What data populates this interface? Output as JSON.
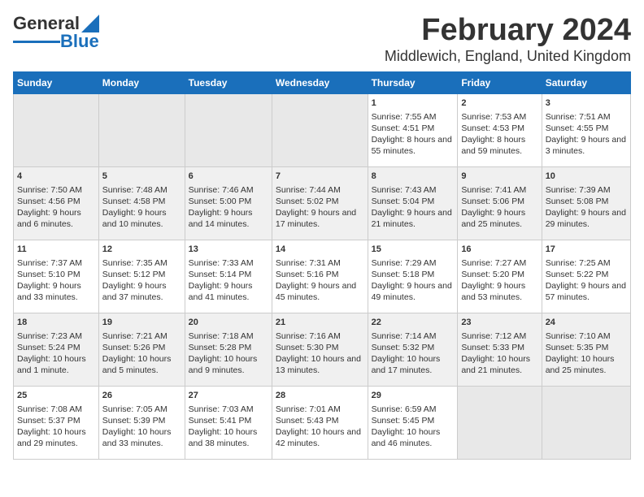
{
  "header": {
    "logo_line1": "General",
    "logo_line2": "Blue",
    "title": "February 2024",
    "subtitle": "Middlewich, England, United Kingdom"
  },
  "columns": [
    "Sunday",
    "Monday",
    "Tuesday",
    "Wednesday",
    "Thursday",
    "Friday",
    "Saturday"
  ],
  "weeks": [
    [
      {
        "day": "",
        "empty": true
      },
      {
        "day": "",
        "empty": true
      },
      {
        "day": "",
        "empty": true
      },
      {
        "day": "",
        "empty": true
      },
      {
        "day": "1",
        "sunrise": "7:55 AM",
        "sunset": "4:51 PM",
        "daylight": "8 hours and 55 minutes."
      },
      {
        "day": "2",
        "sunrise": "7:53 AM",
        "sunset": "4:53 PM",
        "daylight": "8 hours and 59 minutes."
      },
      {
        "day": "3",
        "sunrise": "7:51 AM",
        "sunset": "4:55 PM",
        "daylight": "9 hours and 3 minutes."
      }
    ],
    [
      {
        "day": "4",
        "sunrise": "7:50 AM",
        "sunset": "4:56 PM",
        "daylight": "9 hours and 6 minutes."
      },
      {
        "day": "5",
        "sunrise": "7:48 AM",
        "sunset": "4:58 PM",
        "daylight": "9 hours and 10 minutes."
      },
      {
        "day": "6",
        "sunrise": "7:46 AM",
        "sunset": "5:00 PM",
        "daylight": "9 hours and 14 minutes."
      },
      {
        "day": "7",
        "sunrise": "7:44 AM",
        "sunset": "5:02 PM",
        "daylight": "9 hours and 17 minutes."
      },
      {
        "day": "8",
        "sunrise": "7:43 AM",
        "sunset": "5:04 PM",
        "daylight": "9 hours and 21 minutes."
      },
      {
        "day": "9",
        "sunrise": "7:41 AM",
        "sunset": "5:06 PM",
        "daylight": "9 hours and 25 minutes."
      },
      {
        "day": "10",
        "sunrise": "7:39 AM",
        "sunset": "5:08 PM",
        "daylight": "9 hours and 29 minutes."
      }
    ],
    [
      {
        "day": "11",
        "sunrise": "7:37 AM",
        "sunset": "5:10 PM",
        "daylight": "9 hours and 33 minutes."
      },
      {
        "day": "12",
        "sunrise": "7:35 AM",
        "sunset": "5:12 PM",
        "daylight": "9 hours and 37 minutes."
      },
      {
        "day": "13",
        "sunrise": "7:33 AM",
        "sunset": "5:14 PM",
        "daylight": "9 hours and 41 minutes."
      },
      {
        "day": "14",
        "sunrise": "7:31 AM",
        "sunset": "5:16 PM",
        "daylight": "9 hours and 45 minutes."
      },
      {
        "day": "15",
        "sunrise": "7:29 AM",
        "sunset": "5:18 PM",
        "daylight": "9 hours and 49 minutes."
      },
      {
        "day": "16",
        "sunrise": "7:27 AM",
        "sunset": "5:20 PM",
        "daylight": "9 hours and 53 minutes."
      },
      {
        "day": "17",
        "sunrise": "7:25 AM",
        "sunset": "5:22 PM",
        "daylight": "9 hours and 57 minutes."
      }
    ],
    [
      {
        "day": "18",
        "sunrise": "7:23 AM",
        "sunset": "5:24 PM",
        "daylight": "10 hours and 1 minute."
      },
      {
        "day": "19",
        "sunrise": "7:21 AM",
        "sunset": "5:26 PM",
        "daylight": "10 hours and 5 minutes."
      },
      {
        "day": "20",
        "sunrise": "7:18 AM",
        "sunset": "5:28 PM",
        "daylight": "10 hours and 9 minutes."
      },
      {
        "day": "21",
        "sunrise": "7:16 AM",
        "sunset": "5:30 PM",
        "daylight": "10 hours and 13 minutes."
      },
      {
        "day": "22",
        "sunrise": "7:14 AM",
        "sunset": "5:32 PM",
        "daylight": "10 hours and 17 minutes."
      },
      {
        "day": "23",
        "sunrise": "7:12 AM",
        "sunset": "5:33 PM",
        "daylight": "10 hours and 21 minutes."
      },
      {
        "day": "24",
        "sunrise": "7:10 AM",
        "sunset": "5:35 PM",
        "daylight": "10 hours and 25 minutes."
      }
    ],
    [
      {
        "day": "25",
        "sunrise": "7:08 AM",
        "sunset": "5:37 PM",
        "daylight": "10 hours and 29 minutes."
      },
      {
        "day": "26",
        "sunrise": "7:05 AM",
        "sunset": "5:39 PM",
        "daylight": "10 hours and 33 minutes."
      },
      {
        "day": "27",
        "sunrise": "7:03 AM",
        "sunset": "5:41 PM",
        "daylight": "10 hours and 38 minutes."
      },
      {
        "day": "28",
        "sunrise": "7:01 AM",
        "sunset": "5:43 PM",
        "daylight": "10 hours and 42 minutes."
      },
      {
        "day": "29",
        "sunrise": "6:59 AM",
        "sunset": "5:45 PM",
        "daylight": "10 hours and 46 minutes."
      },
      {
        "day": "",
        "empty": true
      },
      {
        "day": "",
        "empty": true
      }
    ]
  ]
}
